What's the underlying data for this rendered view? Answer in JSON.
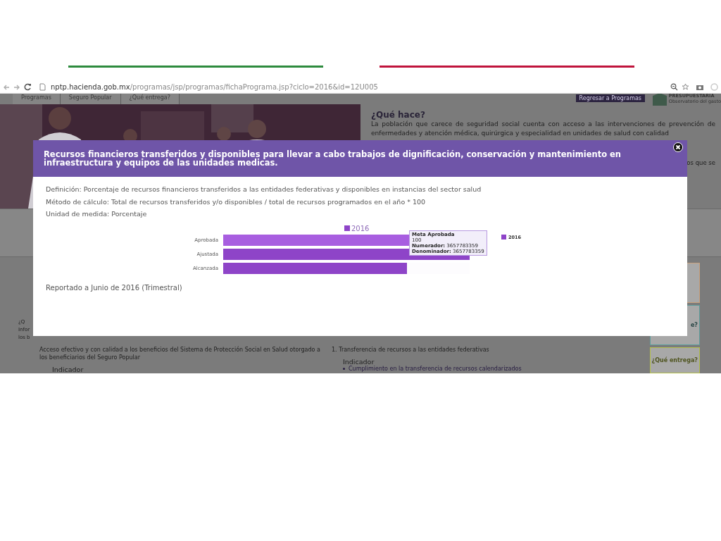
{
  "browser": {
    "url_host": "nptp.hacienda.gob.mx",
    "url_path": "/programas/jsp/programas/fichaPrograma.jsp?ciclo=2016&id=12U005"
  },
  "page": {
    "tabs": [
      "Programas",
      "Seguro Popular",
      "¿Qué entrega?"
    ],
    "back_button": "Regresar a Programas",
    "logo_title": "PRESUPUESTARIA",
    "logo_subtitle": "Observatorio del gasto",
    "que_hace": {
      "heading": "¿Qué hace?",
      "text": "La población que carece de seguridad social cuenta con acceso a las intervenciones de prevención de enfermedades y atención médica, quirúrgica y especialidad en unidades de salud con calidad",
      "tail": "os que se"
    },
    "left_fragments": [
      "¿Q",
      "Infor",
      "los b"
    ],
    "objective": "Acceso efectivo y con calidad a los beneficios del Sistema de Protección Social en Salud otorgado a los beneficiarios del Seguro Popular",
    "objective_label": "Indicador",
    "component": "1. Transferencia de recursos a las entidades federativas",
    "component_label": "Indicador",
    "component_items": [
      "Cumplimiento en la transferencia de recursos calendarizados"
    ],
    "side_cards": [
      {
        "color": "#c9a27e"
      },
      {
        "label": "e?",
        "color": "#5e9e9c"
      },
      {
        "label": "¿Qué entrega?",
        "color": "#b3bf4c"
      }
    ]
  },
  "modal": {
    "title": "Recursos financieros transferidos y disponibles para llevar a cabo trabajos de dignificación, conservación y mantenimiento en infraestructura y equipos de las unidades medicas.",
    "fields": [
      "Definición: Porcentaje de recursos financieros transferidos a las entidades federativas y disponibles en instancias del sector salud",
      "Método de cálculo: Total de recursos transferidos y/o disponibles / total de recursos programados en el año * 100",
      "Unidad de medida: Porcentaje"
    ],
    "chart": {
      "legend": "2016",
      "side_legend": "2016",
      "bars": [
        {
          "label": "Aprobada",
          "level": 1.0,
          "hovered": true
        },
        {
          "label": "Ajustada",
          "level": 1.0,
          "hovered": false
        },
        {
          "label": "Alcanzada",
          "level": 0.745,
          "hovered": false
        }
      ],
      "tooltip": {
        "title": "Meta Aprobada",
        "value": "100",
        "lines": [
          "**Numerador:** 3657783359",
          "**Denominador:** 3657783359"
        ]
      }
    },
    "report": "Reportado a Junio de 2016 (Trimestral)"
  }
}
